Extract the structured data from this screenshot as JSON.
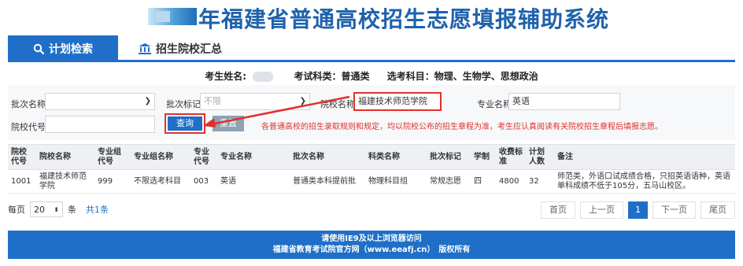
{
  "header": {
    "title": "年福建省普通高校招生志愿填报辅助系统"
  },
  "tabs": [
    {
      "label": "计划检索",
      "icon": "search-icon",
      "active": true
    },
    {
      "label": "招生院校汇总",
      "icon": "bank-icon",
      "active": false
    }
  ],
  "candidate": {
    "name_label": "考生姓名:",
    "subject_type": "考试科类：普通类",
    "elective": "选考科目：物理、生物学、思想政治"
  },
  "form": {
    "batch_label": "批次名称",
    "batch_value": "",
    "batch_mark_label": "批次标记",
    "batch_mark_placeholder": "不限",
    "school_label": "院校名称",
    "school_value": "福建技术师范学院",
    "major_label": "专业名称",
    "major_value": "英语",
    "school_code_label": "院校代号",
    "school_code_value": "",
    "query_label": "查询",
    "reset_label": "重置",
    "notice": "各普通高校的招生录取规则和规定，均以院校公布的招生章程为准，考生应认真阅读有关院校招生章程后填报志愿。"
  },
  "table": {
    "headers": [
      "院校代号",
      "院校名称",
      "专业组代号",
      "专业组名称",
      "专业代号",
      "专业名称",
      "批次名称",
      "科类名称",
      "批次标记",
      "学制",
      "收费标准",
      "计划人数",
      "备注"
    ],
    "rows": [
      [
        "1001",
        "福建技术师范学院",
        "999",
        "不限选考科目",
        "003",
        "英语",
        "普通类本科提前批",
        "物理科目组",
        "常规志愿",
        "四",
        "4800",
        "32",
        "师范类，外语口试成绩合格，只招英语语种，英语单科成绩不低于105分，五马山校区。"
      ]
    ]
  },
  "pager": {
    "per_page_label": "每页",
    "per_page_value": "20",
    "unit": "条",
    "total": "共1条",
    "first": "首页",
    "prev": "上一页",
    "current": "1",
    "next": "下一页",
    "last": "尾页"
  },
  "footer": {
    "line1": "请使用IE9及以上浏览器访问",
    "line2": "福建省教育考试院官方网（www.eeafj.cn）　版权所有"
  },
  "colors": {
    "primary": "#1f6fc8",
    "highlight": "#e0312b",
    "title": "#1e62ac"
  }
}
